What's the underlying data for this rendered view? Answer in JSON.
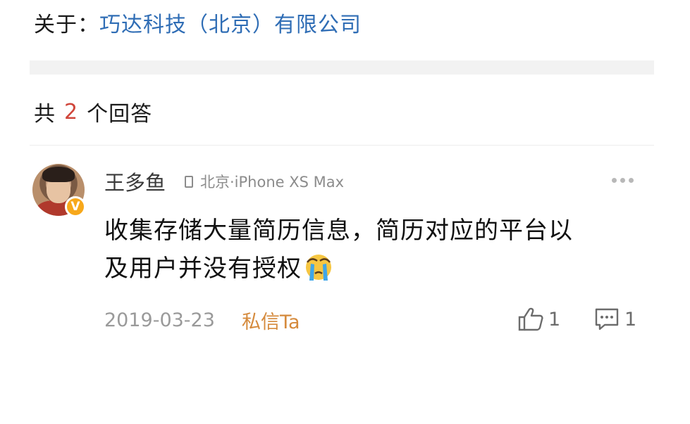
{
  "header": {
    "about_label": "关于：",
    "company_name": "巧达科技（北京）有限公司"
  },
  "answers": {
    "prefix": "共",
    "count": "2",
    "suffix": "个回答"
  },
  "answer": {
    "username": "王多鱼",
    "verified_badge": "V",
    "device": "北京·iPhone XS Max",
    "content_line1": "收集存储大量简历信息，简历对应的平台以",
    "content_line2": "及用户并没有授权",
    "emoji": "crying-face-emoji",
    "date": "2019-03-23",
    "private_message_label": "私信Ta",
    "like_count": "1",
    "comment_count": "1"
  },
  "colors": {
    "company_link": "#2f6db5",
    "count_highlight": "#d0463b",
    "private_message": "#d58a3c",
    "verified_badge": "#f7a81b"
  }
}
